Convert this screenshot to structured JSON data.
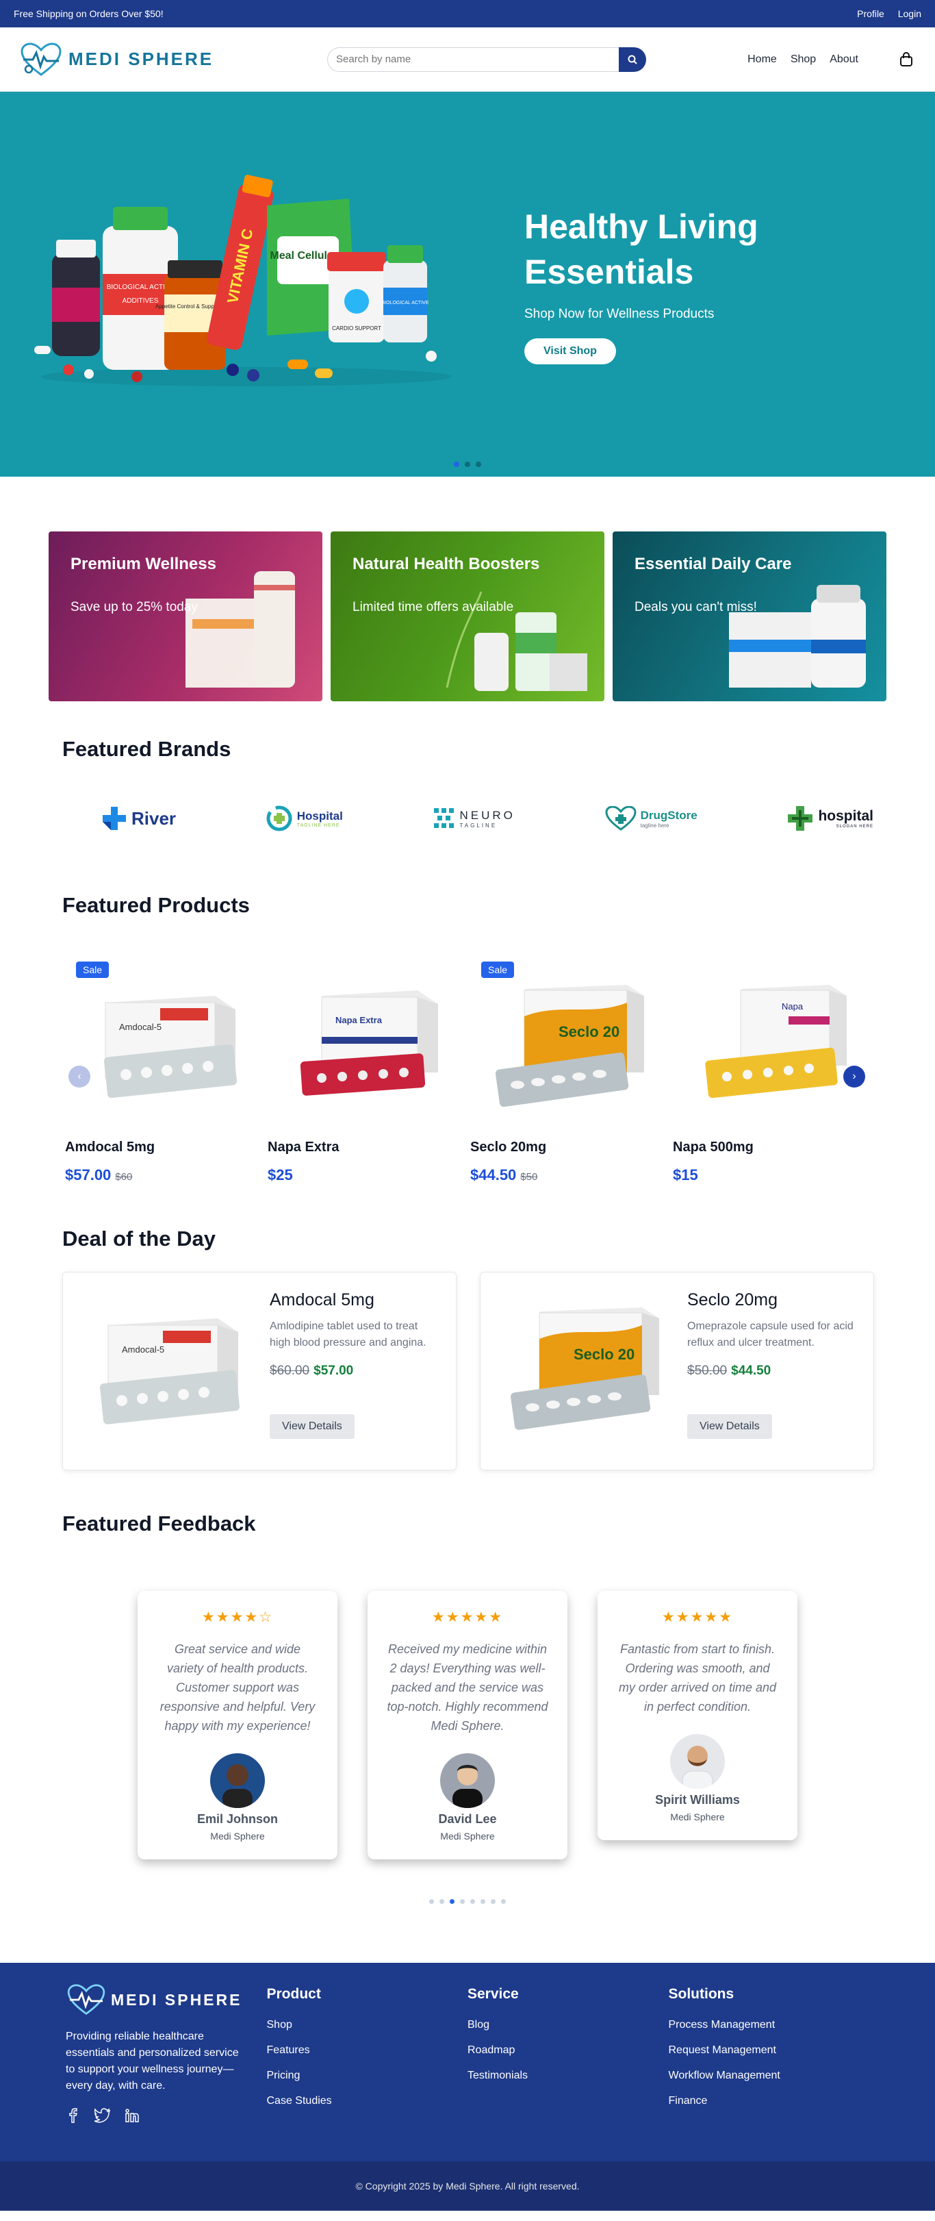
{
  "topbar": {
    "promo": "Free Shipping on Orders Over $50!",
    "profile": "Profile",
    "login": "Login"
  },
  "header": {
    "logo_text": "MEDI SPHERE",
    "search_placeholder": "Search by name",
    "nav": [
      "Home",
      "Shop",
      "About"
    ]
  },
  "hero": {
    "title": "Healthy Living Essentials",
    "subtitle": "Shop Now for Wellness Products",
    "button": "Visit Shop",
    "art_labels": [
      "VITAMIN C",
      "Meal Cellulose",
      "BIOLOGICAL ACTIVE",
      "ADDITIVES",
      "Appetite Control & Suppressants",
      "CARDIO SUPPORT",
      "BIOLOGICAL ACTIVE"
    ],
    "slides": 3,
    "active_slide": 0
  },
  "promos": [
    {
      "title": "Premium Wellness",
      "text": "Save up to 25% today"
    },
    {
      "title": "Natural Health Boosters",
      "text": "Limited time offers available"
    },
    {
      "title": "Essential Daily Care",
      "text": "Deals you can't miss!"
    }
  ],
  "brands": {
    "title": "Featured Brands",
    "items": [
      {
        "name": "River",
        "tagline": ""
      },
      {
        "name": "Hospital",
        "tagline": "TAGLINE HERE"
      },
      {
        "name": "NEURO",
        "tagline": "TAGLINE"
      },
      {
        "name": "DrugStore",
        "tagline": "tagline here"
      },
      {
        "name": "hospital",
        "tagline": "SLOGAN HERE"
      }
    ]
  },
  "products": {
    "title": "Featured Products",
    "items": [
      {
        "name": "Amdocal 5mg",
        "price": "$57.00",
        "old_price": "$60",
        "sale": "Sale",
        "box_label": "Amdocal-5",
        "box_color": "#d8382f"
      },
      {
        "name": "Napa Extra",
        "price": "$25",
        "old_price": "",
        "sale": "",
        "box_label": "Napa Extra",
        "box_color": "#2a3f8f"
      },
      {
        "name": "Seclo 20mg",
        "price": "$44.50",
        "old_price": "$50",
        "sale": "Sale",
        "box_label": "Seclo 20",
        "box_color": "#e99b12"
      },
      {
        "name": "Napa 500mg",
        "price": "$15",
        "old_price": "",
        "sale": "",
        "box_label": "Napa",
        "box_color": "#c0266b"
      }
    ]
  },
  "deals": {
    "title": "Deal of the Day",
    "items": [
      {
        "name": "Amdocal 5mg",
        "desc": "Amlodipine tablet used to treat high blood pressure and angina.",
        "old_price": "$60.00",
        "new_price": "$57.00",
        "button": "View Details",
        "box_label": "Amdocal-5",
        "box_color": "#d8382f"
      },
      {
        "name": "Seclo 20mg",
        "desc": "Omeprazole capsule used for acid reflux and ulcer treatment.",
        "old_price": "$50.00",
        "new_price": "$44.50",
        "button": "View Details",
        "box_label": "Seclo 20",
        "box_color": "#e99b12"
      }
    ]
  },
  "feedback": {
    "title": "Featured Feedback",
    "items": [
      {
        "stars": "★★★★☆",
        "rating": 4,
        "quote": "Great service and wide variety of health products. Customer support was responsive and helpful. Very happy with my experience!",
        "name": "Emil Johnson",
        "org": "Medi Sphere",
        "avatar_bg": "#1e4d8c",
        "skin": "#5b3a29"
      },
      {
        "stars": "★★★★★",
        "rating": 5,
        "quote": "Received my medicine within 2 days! Everything was well-packed and the service was top-notch. Highly recommend Medi Sphere.",
        "name": "David Lee",
        "org": "Medi Sphere",
        "avatar_bg": "#9ca3af",
        "skin": "#e8c4a0"
      },
      {
        "stars": "★★★★★",
        "rating": 5,
        "quote": "Fantastic from start to finish. Ordering was smooth, and my order arrived on time and in perfect condition.",
        "name": "Spirit Williams",
        "org": "Medi Sphere",
        "avatar_bg": "#e5e7eb",
        "skin": "#d9a77e"
      }
    ],
    "pages": 8,
    "active_page": 2
  },
  "footer": {
    "logo_text": "MEDI SPHERE",
    "about": "Providing reliable healthcare essentials and personalized service to support your wellness journey—every day, with care.",
    "columns": [
      {
        "title": "Product",
        "links": [
          "Shop",
          "Features",
          "Pricing",
          "Case Studies"
        ]
      },
      {
        "title": "Service",
        "links": [
          "Blog",
          "Roadmap",
          "Testimonials"
        ]
      },
      {
        "title": "Solutions",
        "links": [
          "Process Management",
          "Request Management",
          "Workflow Management",
          "Finance"
        ]
      }
    ],
    "social": [
      "facebook-icon",
      "twitter-icon",
      "linkedin-icon"
    ],
    "copyright": "© Copyright 2025 by Medi Sphere. All right reserved."
  }
}
